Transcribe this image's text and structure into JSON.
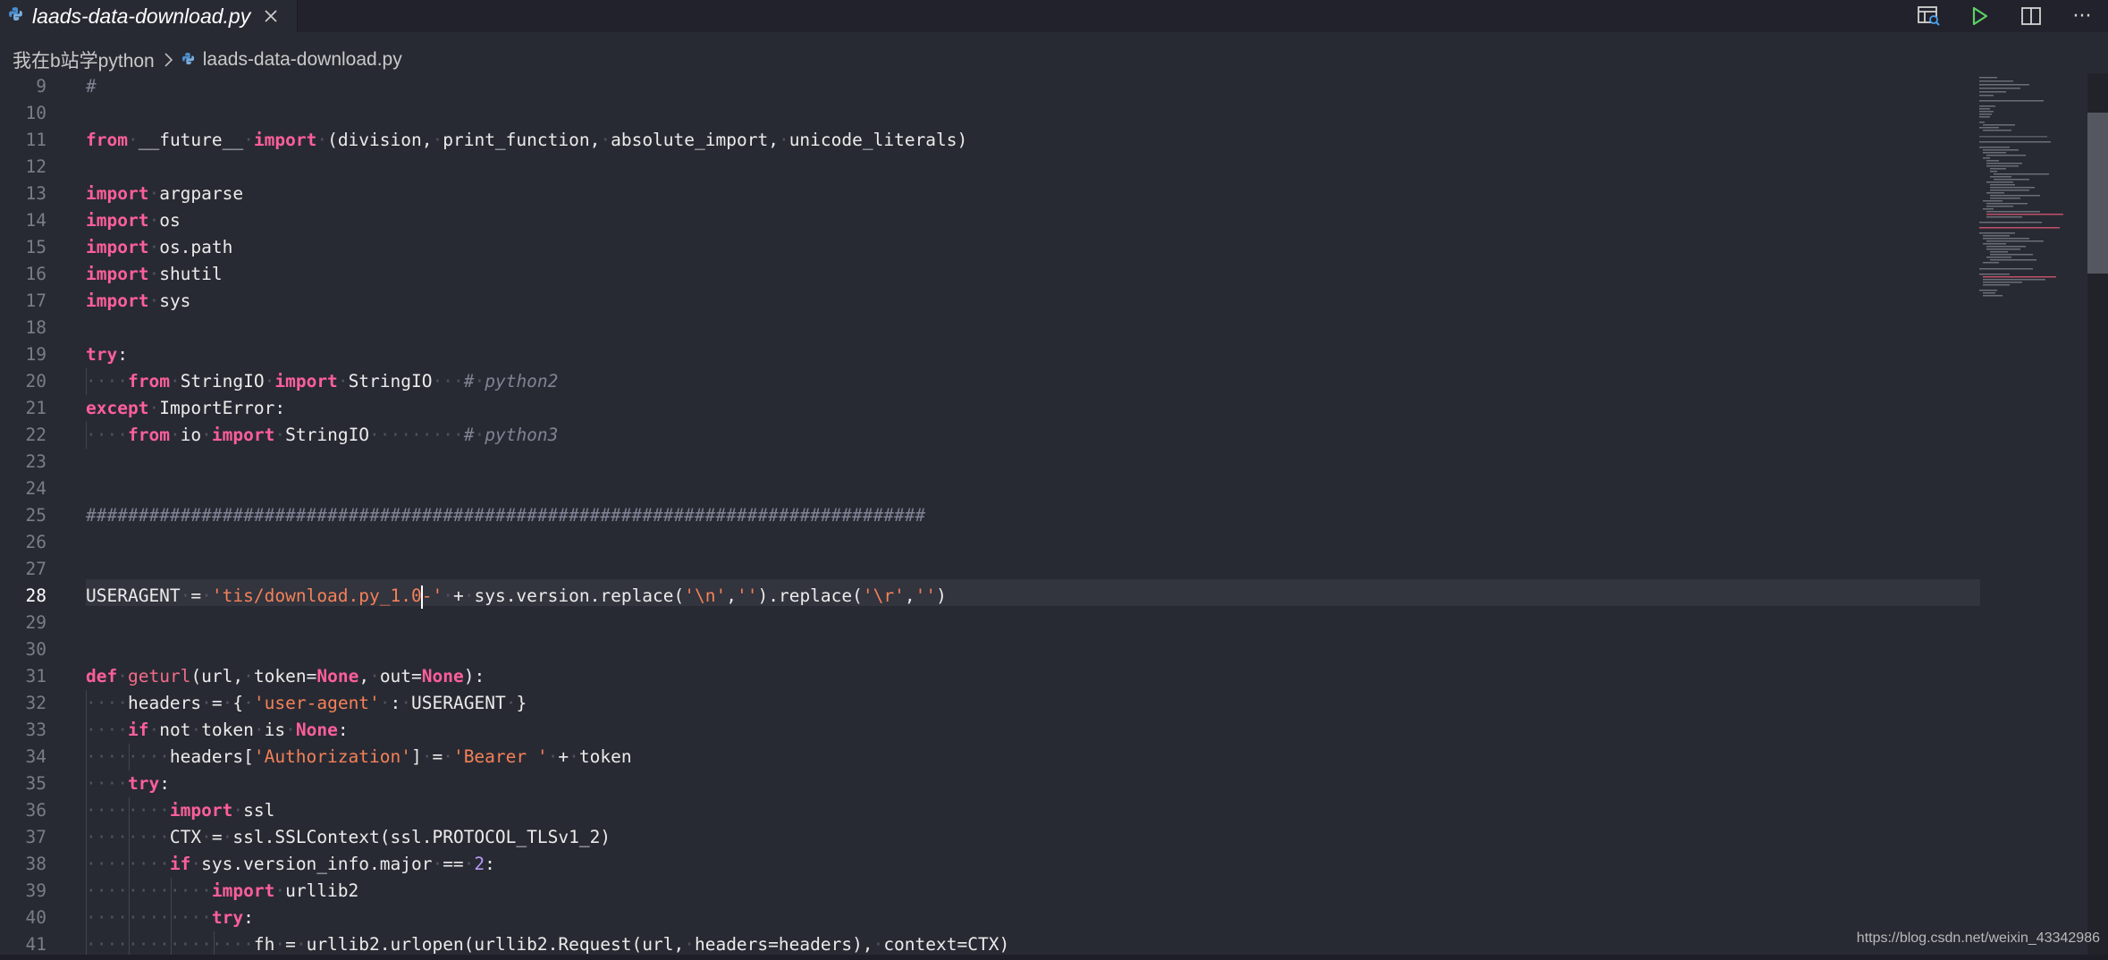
{
  "tab": {
    "title": "laads-data-download.py",
    "icon": "python-file-icon"
  },
  "actions": [
    {
      "name": "open-preview-icon"
    },
    {
      "name": "run-icon"
    },
    {
      "name": "split-editor-icon"
    },
    {
      "name": "more-actions-icon",
      "label": "···"
    }
  ],
  "breadcrumb": {
    "folder": "我在b站学python",
    "file": "laads-data-download.py"
  },
  "editor": {
    "active_line": 28,
    "lines": [
      {
        "n": 9,
        "tokens": [
          [
            "cmt",
            "#"
          ]
        ]
      },
      {
        "n": 10,
        "tokens": []
      },
      {
        "n": 11,
        "tokens": [
          [
            "kw",
            "from"
          ],
          [
            "ws",
            "·"
          ],
          [
            "",
            "__future__"
          ],
          [
            "ws",
            "·"
          ],
          [
            "kw",
            "import"
          ],
          [
            "ws",
            "·"
          ],
          [
            "",
            "(division,"
          ],
          [
            "ws",
            "·"
          ],
          [
            "",
            "print_function,"
          ],
          [
            "ws",
            "·"
          ],
          [
            "",
            "absolute_import,"
          ],
          [
            "ws",
            "·"
          ],
          [
            "",
            "unicode_literals)"
          ]
        ]
      },
      {
        "n": 12,
        "tokens": []
      },
      {
        "n": 13,
        "tokens": [
          [
            "kw",
            "import"
          ],
          [
            "ws",
            "·"
          ],
          [
            "",
            "argparse"
          ]
        ]
      },
      {
        "n": 14,
        "tokens": [
          [
            "kw",
            "import"
          ],
          [
            "ws",
            "·"
          ],
          [
            "",
            "os"
          ]
        ]
      },
      {
        "n": 15,
        "tokens": [
          [
            "kw",
            "import"
          ],
          [
            "ws",
            "·"
          ],
          [
            "",
            "os.path"
          ]
        ]
      },
      {
        "n": 16,
        "tokens": [
          [
            "kw",
            "import"
          ],
          [
            "ws",
            "·"
          ],
          [
            "",
            "shutil"
          ]
        ]
      },
      {
        "n": 17,
        "tokens": [
          [
            "kw",
            "import"
          ],
          [
            "ws",
            "·"
          ],
          [
            "",
            "sys"
          ]
        ]
      },
      {
        "n": 18,
        "tokens": []
      },
      {
        "n": 19,
        "tokens": [
          [
            "kw",
            "try"
          ],
          [
            "",
            ":"
          ]
        ]
      },
      {
        "n": 20,
        "tokens": [
          [
            "ws",
            "····"
          ],
          [
            "kw",
            "from"
          ],
          [
            "ws",
            "·"
          ],
          [
            "",
            "StringIO"
          ],
          [
            "ws",
            "·"
          ],
          [
            "kw",
            "import"
          ],
          [
            "ws",
            "·"
          ],
          [
            "",
            "StringIO"
          ],
          [
            "ws",
            "···"
          ],
          [
            "cmt",
            "#"
          ],
          [
            "ws",
            "·"
          ],
          [
            "cmt",
            "python2"
          ]
        ]
      },
      {
        "n": 21,
        "tokens": [
          [
            "kw",
            "except"
          ],
          [
            "ws",
            "·"
          ],
          [
            "",
            "ImportError:"
          ]
        ]
      },
      {
        "n": 22,
        "tokens": [
          [
            "ws",
            "····"
          ],
          [
            "kw",
            "from"
          ],
          [
            "ws",
            "·"
          ],
          [
            "",
            "io"
          ],
          [
            "ws",
            "·"
          ],
          [
            "kw",
            "import"
          ],
          [
            "ws",
            "·"
          ],
          [
            "",
            "StringIO"
          ],
          [
            "ws",
            "·········"
          ],
          [
            "cmt",
            "#"
          ],
          [
            "ws",
            "·"
          ],
          [
            "cmt",
            "python3"
          ]
        ]
      },
      {
        "n": 23,
        "tokens": []
      },
      {
        "n": 24,
        "tokens": []
      },
      {
        "n": 25,
        "tokens": [
          [
            "cmt",
            "################################################################################"
          ]
        ]
      },
      {
        "n": 26,
        "tokens": []
      },
      {
        "n": 27,
        "tokens": []
      },
      {
        "n": 28,
        "tokens": [
          [
            "",
            "USERAGENT"
          ],
          [
            "ws",
            "·"
          ],
          [
            "",
            "="
          ],
          [
            "ws",
            "·"
          ],
          [
            "str",
            "'tis/download.py_1.0"
          ],
          [
            "cursor",
            ""
          ],
          [
            "str",
            "-'"
          ],
          [
            "ws",
            "·"
          ],
          [
            "",
            "+"
          ],
          [
            "ws",
            "·"
          ],
          [
            "",
            "sys.version.replace("
          ],
          [
            "str",
            "'\\n'"
          ],
          [
            "",
            ","
          ],
          [
            "str",
            "''"
          ],
          [
            "",
            ").replace("
          ],
          [
            "str",
            "'\\r'"
          ],
          [
            "",
            ","
          ],
          [
            "str",
            "''"
          ],
          [
            "",
            ")"
          ]
        ]
      },
      {
        "n": 29,
        "tokens": []
      },
      {
        "n": 30,
        "tokens": []
      },
      {
        "n": 31,
        "tokens": [
          [
            "kw",
            "def"
          ],
          [
            "ws",
            "·"
          ],
          [
            "fn",
            "geturl"
          ],
          [
            "",
            "(url,"
          ],
          [
            "ws",
            "·"
          ],
          [
            "",
            "token="
          ],
          [
            "kw",
            "None"
          ],
          [
            "",
            ","
          ],
          [
            "ws",
            "·"
          ],
          [
            "",
            "out="
          ],
          [
            "kw",
            "None"
          ],
          [
            "",
            "):"
          ]
        ]
      },
      {
        "n": 32,
        "tokens": [
          [
            "ws",
            "····"
          ],
          [
            "",
            "headers"
          ],
          [
            "ws",
            "·"
          ],
          [
            "",
            "="
          ],
          [
            "ws",
            "·"
          ],
          [
            "",
            "{"
          ],
          [
            "ws",
            "·"
          ],
          [
            "str",
            "'user-agent'"
          ],
          [
            "ws",
            "·"
          ],
          [
            "",
            ":"
          ],
          [
            "ws",
            "·"
          ],
          [
            "",
            "USERAGENT"
          ],
          [
            "ws",
            "·"
          ],
          [
            "",
            "}"
          ]
        ]
      },
      {
        "n": 33,
        "tokens": [
          [
            "ws",
            "····"
          ],
          [
            "kw",
            "if"
          ],
          [
            "ws",
            "·"
          ],
          [
            "",
            "not"
          ],
          [
            "ws",
            "·"
          ],
          [
            "",
            "token"
          ],
          [
            "ws",
            "·"
          ],
          [
            "",
            "is"
          ],
          [
            "ws",
            "·"
          ],
          [
            "kw",
            "None"
          ],
          [
            "",
            ":"
          ]
        ]
      },
      {
        "n": 34,
        "tokens": [
          [
            "ws",
            "········"
          ],
          [
            "",
            "headers["
          ],
          [
            "str",
            "'Authorization'"
          ],
          [
            "",
            "]"
          ],
          [
            "ws",
            "·"
          ],
          [
            "",
            "="
          ],
          [
            "ws",
            "·"
          ],
          [
            "str",
            "'Bearer '"
          ],
          [
            "ws",
            "·"
          ],
          [
            "",
            "+"
          ],
          [
            "ws",
            "·"
          ],
          [
            "",
            "token"
          ]
        ]
      },
      {
        "n": 35,
        "tokens": [
          [
            "ws",
            "····"
          ],
          [
            "kw",
            "try"
          ],
          [
            "",
            ":"
          ]
        ]
      },
      {
        "n": 36,
        "tokens": [
          [
            "ws",
            "········"
          ],
          [
            "kw",
            "import"
          ],
          [
            "ws",
            "·"
          ],
          [
            "",
            "ssl"
          ]
        ]
      },
      {
        "n": 37,
        "tokens": [
          [
            "ws",
            "········"
          ],
          [
            "",
            "CTX"
          ],
          [
            "ws",
            "·"
          ],
          [
            "",
            "="
          ],
          [
            "ws",
            "·"
          ],
          [
            "",
            "ssl.SSLContext(ssl.PROTOCOL_TLSv1_2)"
          ]
        ]
      },
      {
        "n": 38,
        "tokens": [
          [
            "ws",
            "········"
          ],
          [
            "kw",
            "if"
          ],
          [
            "ws",
            "·"
          ],
          [
            "",
            "sys.version_info.major"
          ],
          [
            "ws",
            "·"
          ],
          [
            "",
            "=="
          ],
          [
            "ws",
            "·"
          ],
          [
            "num",
            "2"
          ],
          [
            "",
            ":"
          ]
        ]
      },
      {
        "n": 39,
        "tokens": [
          [
            "ws",
            "············"
          ],
          [
            "kw",
            "import"
          ],
          [
            "ws",
            "·"
          ],
          [
            "",
            "urllib2"
          ]
        ]
      },
      {
        "n": 40,
        "tokens": [
          [
            "ws",
            "············"
          ],
          [
            "kw",
            "try"
          ],
          [
            "",
            ":"
          ]
        ]
      },
      {
        "n": 41,
        "tokens": [
          [
            "ws",
            "················"
          ],
          [
            "",
            "fh"
          ],
          [
            "ws",
            "·"
          ],
          [
            "",
            "="
          ],
          [
            "ws",
            "·"
          ],
          [
            "",
            "urllib2.urlopen(urllib2.Request(url,"
          ],
          [
            "ws",
            "·"
          ],
          [
            "",
            "headers=headers),"
          ],
          [
            "ws",
            "·"
          ],
          [
            "",
            "context=CTX)"
          ]
        ]
      }
    ]
  },
  "colors": {
    "background": "#282a33",
    "keyword": "#fc5f9a",
    "string": "#f48158",
    "number": "#b69af7",
    "comment": "#7f8394"
  },
  "watermark": "https://blog.csdn.net/weixin_43342986"
}
